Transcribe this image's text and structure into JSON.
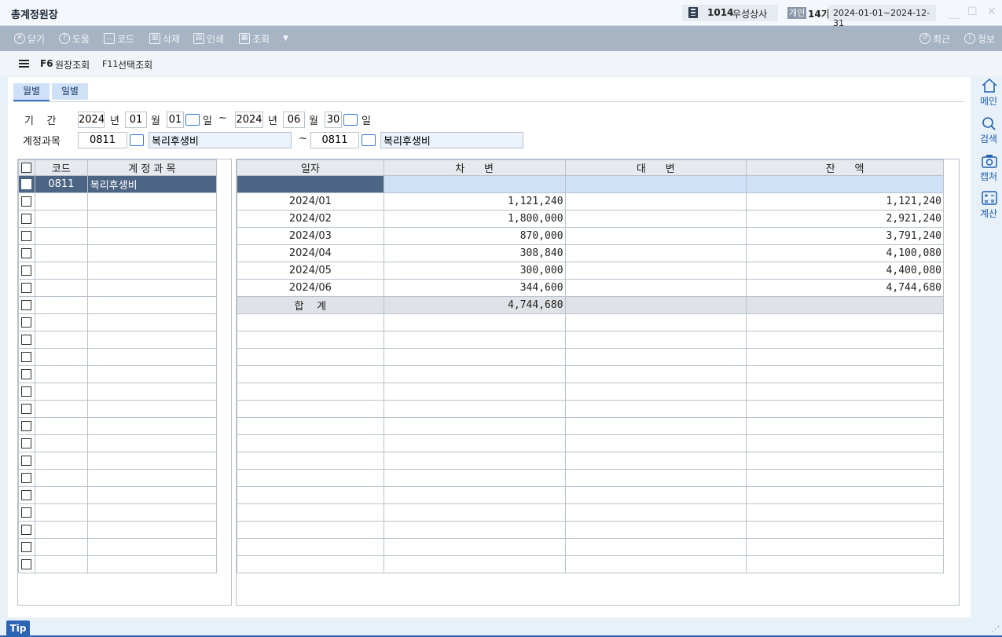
{
  "window": {
    "title": "총계정원장",
    "company_code": "1014",
    "company_name": "우성상사",
    "business_type": "개인",
    "fiscal_term": "14기",
    "fiscal_period": "2024-01-01~2024-12-31"
  },
  "toolbar": {
    "close": "닫기",
    "help": "도움",
    "code": "코드",
    "delete": "삭제",
    "print": "인쇄",
    "inquiry": "조회",
    "recent": "최근",
    "info": "정보"
  },
  "funcbar": {
    "f6_key": "F6",
    "f6_label": "원장조회",
    "f11_key": "F11",
    "f11_label": "선택조회"
  },
  "tabs": {
    "monthly": "월별",
    "daily": "일별"
  },
  "filters": {
    "period_label": "기    간",
    "from_year": "2024",
    "year_unit": "년",
    "from_month": "01",
    "month_unit": "월",
    "from_day": "01",
    "day_unit": "일",
    "tilde": "~",
    "to_year": "2024",
    "to_month": "06",
    "to_day": "30",
    "account_label": "계정과목",
    "from_account_code": "0811",
    "from_account_name": "복리후생비",
    "to_account_code": "0811",
    "to_account_name": "복리후생비"
  },
  "account_table": {
    "headers": {
      "code": "코드",
      "name": "계 정 과 목"
    },
    "rows": [
      {
        "code": "0811",
        "name": "복리후생비"
      }
    ],
    "empty_rows": 22
  },
  "ledger_table": {
    "headers": {
      "date": "일자",
      "debit": "차      변",
      "credit": "대      변",
      "balance": "잔      액"
    },
    "rows": [
      {
        "date": "2024/01",
        "debit": "1,121,240",
        "credit": "",
        "balance": "1,121,240"
      },
      {
        "date": "2024/02",
        "debit": "1,800,000",
        "credit": "",
        "balance": "2,921,240"
      },
      {
        "date": "2024/03",
        "debit": "870,000",
        "credit": "",
        "balance": "3,791,240"
      },
      {
        "date": "2024/04",
        "debit": "308,840",
        "credit": "",
        "balance": "4,100,080"
      },
      {
        "date": "2024/05",
        "debit": "300,000",
        "credit": "",
        "balance": "4,400,080"
      },
      {
        "date": "2024/06",
        "debit": "344,600",
        "credit": "",
        "balance": "4,744,680"
      }
    ],
    "total": {
      "label": "합    계",
      "debit": "4,744,680",
      "credit": "",
      "balance": ""
    },
    "empty_rows": 15
  },
  "sidebar": {
    "home": "메인",
    "search": "검색",
    "capture": "캡처",
    "calc": "계산"
  },
  "statusbar": {
    "tip": "Tip"
  }
}
